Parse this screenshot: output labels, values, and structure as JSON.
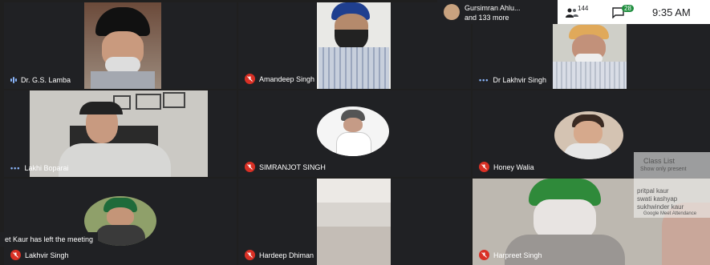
{
  "participants": [
    {
      "name": "Dr. G.S. Lamba",
      "status": "speaking"
    },
    {
      "name": "Amandeep Singh",
      "status": "muted"
    },
    {
      "name": "Dr Lakhvir Singh",
      "status": "more"
    },
    {
      "name": "Lakhi Boparai",
      "status": "more"
    },
    {
      "name": "SIMRANJOT SINGH",
      "status": "muted"
    },
    {
      "name": "Honey Walia",
      "status": "muted"
    },
    {
      "name": "Lakhvir Singh",
      "status": "muted"
    },
    {
      "name": "Hardeep Dhiman",
      "status": "muted"
    },
    {
      "name": "Harpreet Singh",
      "status": "muted"
    }
  ],
  "topbar": {
    "presenter_name": "Gursimran Ahlu...",
    "more_label": "and 133 more",
    "people_count": "144",
    "chat_count": "28",
    "time": "9:35 AM"
  },
  "class_panel": {
    "title": "Class List",
    "subtitle": "Show only present",
    "entries": [
      "pritpal kaur",
      "swati kashyap",
      "sukhwinder kaur"
    ],
    "footer": "Google Meet Attendance"
  },
  "toast": {
    "message": "et Kaur has left the meeting"
  },
  "colors": {
    "tile_bg": "#202124",
    "muted_red": "#d93025",
    "accent_blue": "#8ab4f8",
    "chat_green": "#1e8e3e"
  }
}
